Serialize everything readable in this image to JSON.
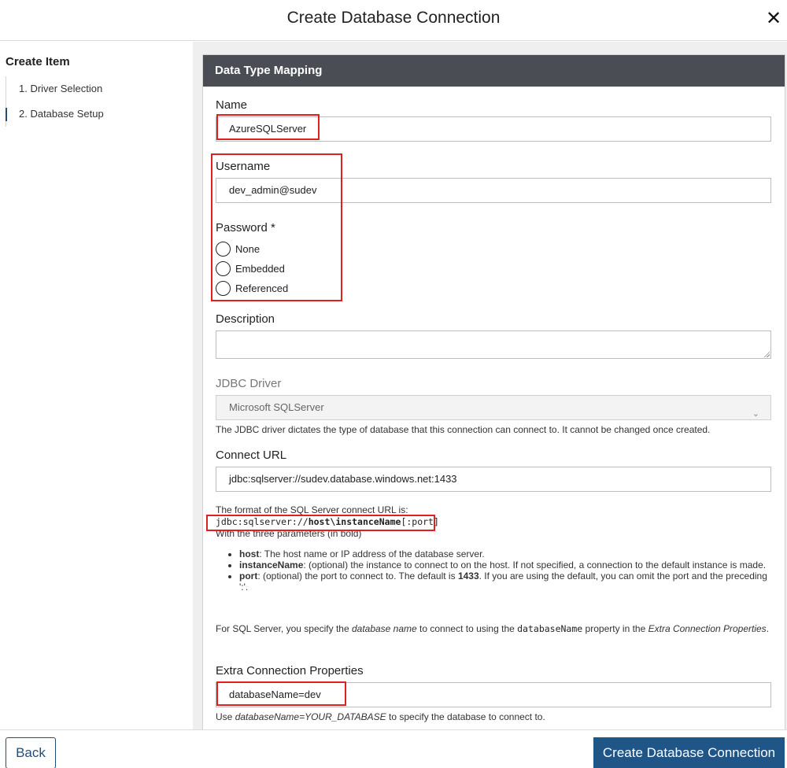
{
  "dialog": {
    "title": "Create Database Connection",
    "close_icon": "close-icon"
  },
  "sidebar": {
    "heading": "Create Item",
    "steps": [
      {
        "label": "1. Driver Selection",
        "active": false
      },
      {
        "label": "2. Database Setup",
        "active": true
      }
    ]
  },
  "panel": {
    "title": "Data Type Mapping"
  },
  "form": {
    "name": {
      "label": "Name",
      "value": "AzureSQLServer"
    },
    "username": {
      "label": "Username",
      "value": "dev_admin@sudev"
    },
    "password": {
      "label": "Password *",
      "options": [
        "None",
        "Embedded",
        "Referenced"
      ]
    },
    "description": {
      "label": "Description",
      "value": ""
    },
    "jdbc_driver": {
      "label": "JDBC Driver",
      "value": "Microsoft SQLServer",
      "help": "The JDBC driver dictates the type of database that this connection can connect to. It cannot be changed once created."
    },
    "connect_url": {
      "label": "Connect URL",
      "value": "jdbc:sqlserver://sudev.database.windows.net:1433",
      "help_intro": "The format of the SQL Server connect URL is:",
      "format_prefix": "jdbc:sqlserver://",
      "format_host": "host",
      "format_sep": "\\",
      "format_instance": "instanceName",
      "format_port": "[:port]",
      "help_params": "With the three parameters (in bold)",
      "bullets": [
        {
          "term": "host",
          "text": ": The host name or IP address of the database server."
        },
        {
          "term": "instanceName",
          "text": ": (optional) the instance to connect to on the host. If not specified, a connection to the default instance is made."
        },
        {
          "term": "port",
          "text_before": ": (optional) the port to connect to. The default is ",
          "bold": "1433",
          "text_after": ". If you are using the default, you can omit the port and the preceding ':'."
        }
      ],
      "note_part1": "For SQL Server, you specify the ",
      "note_em1": "database name",
      "note_part2": " to connect to using the ",
      "note_code": "databaseName",
      "note_part3": " property in the ",
      "note_em2": "Extra Connection Properties",
      "note_part4": "."
    },
    "extra_props": {
      "label": "Extra Connection Properties",
      "value": "databaseName=dev",
      "help_part1": "Use ",
      "help_em": "databaseName=YOUR_DATABASE",
      "help_part2": " to specify the database to connect to."
    }
  },
  "footer": {
    "back_label": "Back",
    "create_label": "Create Database Connection"
  },
  "highlight_color": "#e02020",
  "primary_color": "#1f5587"
}
